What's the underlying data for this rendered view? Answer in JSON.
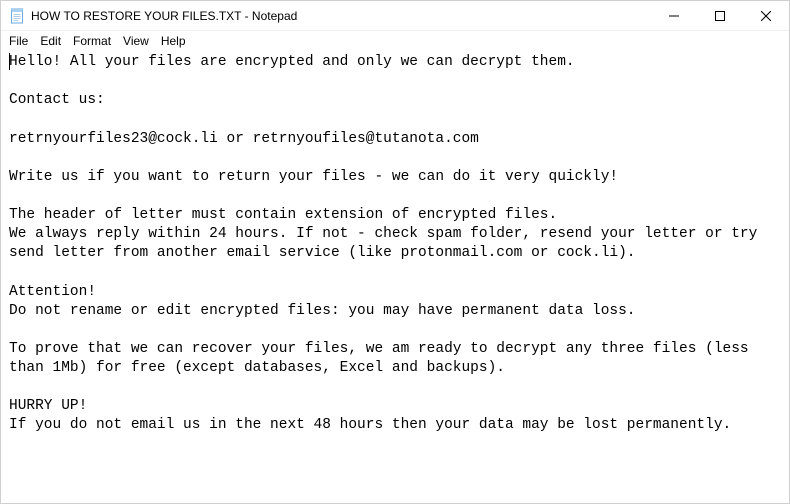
{
  "titlebar": {
    "title": "HOW TO RESTORE YOUR FILES.TXT - Notepad"
  },
  "menubar": {
    "items": [
      "File",
      "Edit",
      "Format",
      "View",
      "Help"
    ]
  },
  "content": {
    "text": "Hello! All your files are encrypted and only we can decrypt them.\n\nContact us:\n\nretrnyourfiles23@cock.li or retrnyoufiles@tutanota.com\n\nWrite us if you want to return your files - we can do it very quickly!\n\nThe header of letter must contain extension of encrypted files.\nWe always reply within 24 hours. If not - check spam folder, resend your letter or try send letter from another email service (like protonmail.com or cock.li).\n\nAttention!\nDo not rename or edit encrypted files: you may have permanent data loss.\n\nTo prove that we can recover your files, we am ready to decrypt any three files (less than 1Mb) for free (except databases, Excel and backups).\n\nHURRY UP!\nIf you do not email us in the next 48 hours then your data may be lost permanently."
  }
}
